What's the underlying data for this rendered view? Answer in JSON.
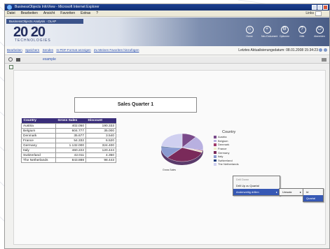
{
  "window": {
    "title": "BusinessObjects InfoView - Microsoft Internet Explorer",
    "menu": [
      "Datei",
      "Bearbeiten",
      "Ansicht",
      "Favoriten",
      "Extras",
      "?"
    ],
    "links_label": "Links"
  },
  "app": {
    "tab_label": "BusinessObjects Analysis · OLAP",
    "logo": "20 20",
    "logo_sub": "TECHNOLOGIES",
    "toolbar": [
      "Home",
      "Neu Dokument",
      "Optionen",
      "Hilfe",
      "Abmelden"
    ]
  },
  "links_bar": {
    "links": [
      "Bearbeiten",
      "Speichern",
      "Senden",
      "In PDF-Format anzeigen",
      "Zu Meinen Favoriten hinzufügen"
    ],
    "status": "Letztes Aktualisierungsdatum: 08.01.2008 15:34:23"
  },
  "document": {
    "name": "example"
  },
  "report": {
    "title": "Sales Quarter 1",
    "table": {
      "headers": [
        "Country",
        "Gross Sales",
        "Discount"
      ],
      "rows": [
        [
          "Austria",
          "402.050",
          "190.333"
        ],
        [
          "Belgium",
          "604.777",
          "35.000"
        ],
        [
          "Denmark",
          "35.677",
          "3.540"
        ],
        [
          "France",
          "54.332",
          "6.520"
        ],
        [
          "Germany",
          "1.132.000",
          "324.400"
        ],
        [
          "Italy",
          "460.222",
          "120.444"
        ],
        [
          "Switzerland",
          "42.011",
          "4.350"
        ],
        [
          "The Netherlands",
          "843.888",
          "98.443"
        ]
      ]
    },
    "pie_caption": "Gross Sales",
    "legend_title": "Country",
    "legend": [
      {
        "name": "Austria",
        "color": "#7a4a8a"
      },
      {
        "name": "Belgium",
        "color": "#b8b0e0"
      },
      {
        "name": "Denmark",
        "color": "#a03a6a"
      },
      {
        "name": "France",
        "color": "#eeeec8"
      },
      {
        "name": "Germany",
        "color": "#7a2a5a"
      },
      {
        "name": "Italy",
        "color": "#8a9ad0"
      },
      {
        "name": "Switzerland",
        "color": "#1a3a7a"
      },
      {
        "name": "The Netherlands",
        "color": "#d0d0f0"
      }
    ]
  },
  "context_menu": {
    "items": [
      "Drill Down",
      "Drill Up zu Quartal",
      "Anderweitig drillen"
    ],
    "sub1": [
      "Umsatz"
    ],
    "sub2": [
      "Id",
      "Quartal"
    ]
  },
  "chart_data": {
    "type": "pie",
    "title": "",
    "categories": [
      "Austria",
      "Belgium",
      "Denmark",
      "France",
      "Germany",
      "Italy",
      "Switzerland",
      "The Netherlands"
    ],
    "values": [
      402050,
      604777,
      35677,
      54332,
      1132000,
      460222,
      42011,
      843888
    ],
    "colors": [
      "#7a4a8a",
      "#b8b0e0",
      "#a03a6a",
      "#eeeec8",
      "#7a2a5a",
      "#8a9ad0",
      "#1a3a7a",
      "#d0d0f0"
    ],
    "legend_position": "right"
  }
}
